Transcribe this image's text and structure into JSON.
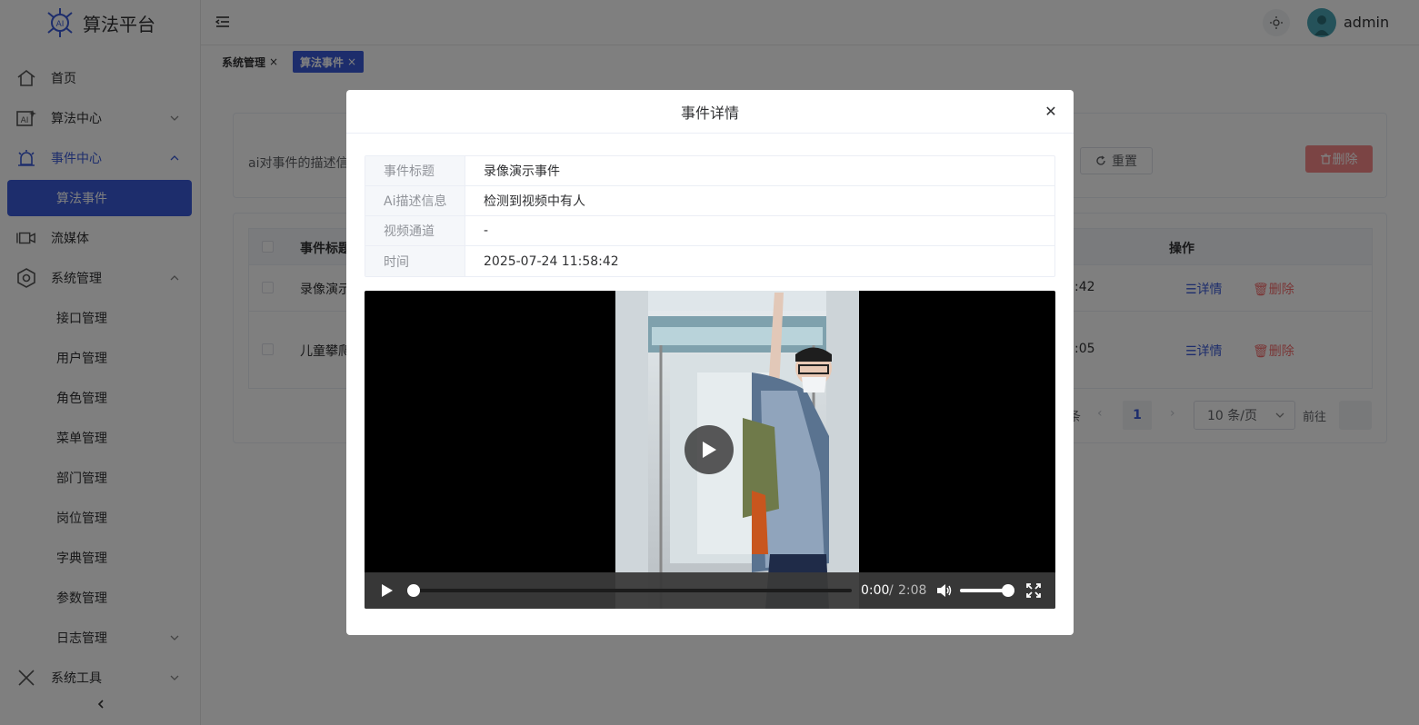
{
  "app": {
    "title": "算法平台",
    "username": "admin"
  },
  "sidebar": {
    "items": [
      {
        "label": "首页",
        "icon": "home-icon"
      },
      {
        "label": "算法中心",
        "icon": "ai-icon"
      },
      {
        "label": "事件中心",
        "icon": "alarm-icon",
        "expanded": true
      },
      {
        "label": "算法事件",
        "selected": true
      },
      {
        "label": "流媒体",
        "icon": "camera-icon"
      },
      {
        "label": "系统管理",
        "icon": "settings-icon",
        "expanded": true
      },
      {
        "label": "接口管理"
      },
      {
        "label": "用户管理"
      },
      {
        "label": "角色管理"
      },
      {
        "label": "菜单管理"
      },
      {
        "label": "部门管理"
      },
      {
        "label": "岗位管理"
      },
      {
        "label": "字典管理"
      },
      {
        "label": "参数管理"
      },
      {
        "label": "日志管理"
      },
      {
        "label": "系统工具",
        "icon": "tools-icon"
      }
    ]
  },
  "tags": [
    {
      "label": "系统管理"
    },
    {
      "label": "算法事件",
      "active": true
    }
  ],
  "search": {
    "label": "ai对事件的描述信",
    "reset_label": "重置",
    "delete_label": "删除"
  },
  "table": {
    "headers": {
      "title": "事件标题",
      "actions": "操作"
    },
    "rows": [
      {
        "title": "录像演示",
        "time_suffix": ":42",
        "detail": "详情",
        "delete": "删除"
      },
      {
        "title": "儿童攀爬",
        "time_suffix": ":05",
        "detail": "详情",
        "delete": "删除"
      }
    ]
  },
  "pagination": {
    "prefix_partial": "条",
    "current_page": "1",
    "page_size": "10 条/页",
    "goto_label": "前往"
  },
  "dialog": {
    "title": "事件详情",
    "fields": [
      {
        "label": "事件标题",
        "value": "录像演示事件"
      },
      {
        "label": "Ai描述信息",
        "value": "检测到视频中有人"
      },
      {
        "label": "视频通道",
        "value": "-"
      },
      {
        "label": "时间",
        "value": "2025-07-24 11:58:42"
      }
    ],
    "video": {
      "current_time": "0:00",
      "separator": "/",
      "duration": "2:08",
      "progress": 0,
      "volume": 1
    }
  }
}
